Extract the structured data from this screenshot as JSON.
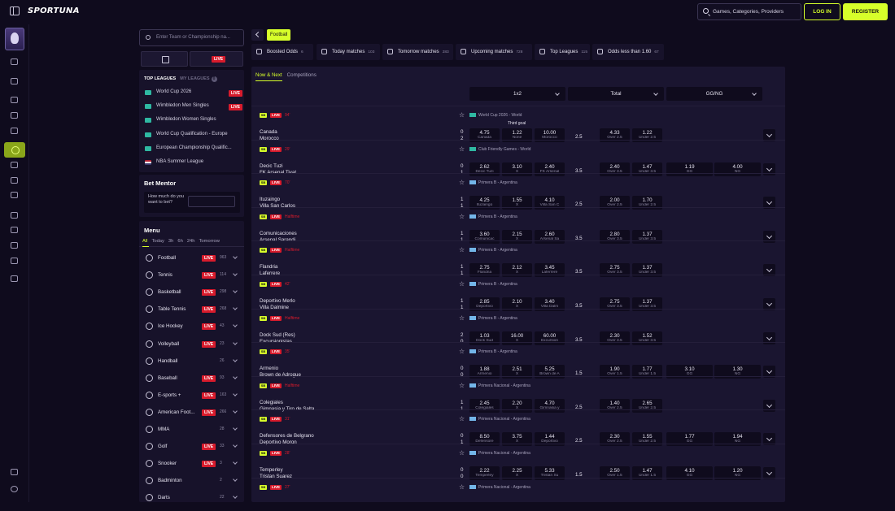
{
  "header": {
    "logo": "SPORTUNA",
    "search_placeholder": "Games, Categories, Providers",
    "login": "LOG IN",
    "register": "REGISTER"
  },
  "sidebar": {
    "search_placeholder": "Enter Team or Championship na...",
    "live_tab": "LIVE",
    "leagues_tabs": {
      "top": "TOP LEAGUES",
      "my": "MY LEAGUES",
      "my_count": "0"
    },
    "leagues": [
      {
        "name": "World Cup 2026",
        "live": "LIVE",
        "flag": "world"
      },
      {
        "name": "Wimbledon Men Singles",
        "live": "LIVE",
        "flag": "world"
      },
      {
        "name": "Wimbledon Women Singles",
        "live": "",
        "flag": "world"
      },
      {
        "name": "World Cup Qualification - Europe",
        "live": "",
        "flag": "world"
      },
      {
        "name": "European Championship Qualific...",
        "live": "",
        "flag": "world"
      },
      {
        "name": "NBA Summer League",
        "live": "",
        "flag": "us"
      }
    ],
    "bet_mentor": {
      "title": "Bet Mentor",
      "question": "How much do you want to bet?"
    },
    "menu": {
      "title": "Menu",
      "time_tabs": [
        "All",
        "Today",
        "3h",
        "6h",
        "24h",
        "Tomorrow"
      ],
      "sports": [
        {
          "name": "Football",
          "live": "LIVE",
          "count": "963"
        },
        {
          "name": "Tennis",
          "live": "LIVE",
          "count": "114"
        },
        {
          "name": "Basketball",
          "live": "LIVE",
          "count": "298"
        },
        {
          "name": "Table Tennis",
          "live": "LIVE",
          "count": "268"
        },
        {
          "name": "Ice Hockey",
          "live": "LIVE",
          "count": "43"
        },
        {
          "name": "Volleyball",
          "live": "LIVE",
          "count": "23"
        },
        {
          "name": "Handball",
          "live": "",
          "count": "26"
        },
        {
          "name": "Baseball",
          "live": "LIVE",
          "count": "93"
        },
        {
          "name": "E-sports +",
          "live": "LIVE",
          "count": "163"
        },
        {
          "name": "American Foot...",
          "live": "LIVE",
          "count": "266"
        },
        {
          "name": "MMA",
          "live": "",
          "count": "28"
        },
        {
          "name": "Golf",
          "live": "LIVE",
          "count": "33"
        },
        {
          "name": "Snooker",
          "live": "LIVE",
          "count": "3"
        },
        {
          "name": "Badminton",
          "live": "",
          "count": "2"
        },
        {
          "name": "Darts",
          "live": "",
          "count": "22"
        }
      ]
    }
  },
  "main": {
    "breadcrumb": "Football",
    "filters": [
      {
        "label": "Boosted Odds",
        "count": "6"
      },
      {
        "label": "Today matches",
        "count": "103"
      },
      {
        "label": "Tomorrow matches",
        "count": "283"
      },
      {
        "label": "Upcoming matches",
        "count": "728"
      },
      {
        "label": "Top Leagues",
        "count": "115"
      },
      {
        "label": "Odds less than 1.60",
        "count": "67"
      }
    ],
    "subtabs": {
      "active": "Now & Next",
      "other": "Competitions"
    },
    "columns": {
      "c1": "1x2",
      "c2": "Total",
      "c3": "GG/NG"
    },
    "matches": [
      {
        "min": "94'",
        "comp": "World Cup 2026 - World",
        "flag": "wc",
        "home": "Canada",
        "away": "Morocco",
        "sh": "0",
        "sa": "2",
        "extra": "Third goal",
        "o1": [
          "4.75",
          "Canada"
        ],
        "ox": [
          "1.22",
          "None"
        ],
        "o2": [
          "10.00",
          "Morocco"
        ],
        "line": "2.5",
        "ov": [
          "4.33",
          "Over 2.5"
        ],
        "un": [
          "1.22",
          "Under 2.5"
        ],
        "gg": null,
        "ng": null
      },
      {
        "min": "29'",
        "comp": "Club Friendly Games - World",
        "flag": "wc",
        "home": "Decic Tuzi",
        "away": "FK Arsenal Tivat",
        "sh": "0",
        "sa": "1",
        "extra": "",
        "o1": [
          "2.62",
          "Decic Tuzi"
        ],
        "ox": [
          "3.10",
          "X"
        ],
        "o2": [
          "2.40",
          "FK Arsenal"
        ],
        "line": "3.5",
        "ov": [
          "2.40",
          "Over 3.5"
        ],
        "un": [
          "1.47",
          "Under 3.5"
        ],
        "gg": [
          "1.19",
          "GG"
        ],
        "ng": [
          "4.00",
          "NG"
        ]
      },
      {
        "min": "70'",
        "comp": "Primera B - Argentina",
        "flag": "ar",
        "home": "Ituzaingo",
        "away": "Villa San Carlos",
        "sh": "1",
        "sa": "1",
        "extra": "",
        "o1": [
          "4.25",
          "Ituzaingo"
        ],
        "ox": [
          "1.55",
          "X"
        ],
        "o2": [
          "4.10",
          "Villa San C"
        ],
        "line": "2.5",
        "ov": [
          "2.00",
          "Over 2.5"
        ],
        "un": [
          "1.70",
          "Under 2.5"
        ],
        "gg": null,
        "ng": null
      },
      {
        "min": "Halftime",
        "comp": "Primera B - Argentina",
        "flag": "ar",
        "home": "Comunicaciones",
        "away": "Arsenal Sarandi",
        "sh": "1",
        "sa": "1",
        "extra": "",
        "o1": [
          "3.60",
          "Comunicac"
        ],
        "ox": [
          "2.15",
          "X"
        ],
        "o2": [
          "2.60",
          "Arsenal Sa"
        ],
        "line": "3.5",
        "ov": [
          "2.80",
          "Over 3.5"
        ],
        "un": [
          "1.37",
          "Under 3.5"
        ],
        "gg": null,
        "ng": null
      },
      {
        "min": "Halftime",
        "comp": "Primera B - Argentina",
        "flag": "ar",
        "home": "Flandria",
        "away": "Laferrere",
        "sh": "1",
        "sa": "1",
        "extra": "",
        "o1": [
          "2.75",
          "Flandria"
        ],
        "ox": [
          "2.12",
          "X"
        ],
        "o2": [
          "3.45",
          "Laferrere"
        ],
        "line": "3.5",
        "ov": [
          "2.75",
          "Over 3.5"
        ],
        "un": [
          "1.37",
          "Under 3.5"
        ],
        "gg": null,
        "ng": null
      },
      {
        "min": "42'",
        "comp": "Primera B - Argentina",
        "flag": "ar",
        "home": "Deportivo Merlo",
        "away": "Villa Dalmine",
        "sh": "1",
        "sa": "1",
        "extra": "",
        "o1": [
          "2.85",
          "Deportivo"
        ],
        "ox": [
          "2.10",
          "X"
        ],
        "o2": [
          "3.40",
          "Villa Dalm"
        ],
        "line": "3.5",
        "ov": [
          "2.75",
          "Over 3.5"
        ],
        "un": [
          "1.37",
          "Under 3.5"
        ],
        "gg": null,
        "ng": null
      },
      {
        "min": "Halftime",
        "comp": "Primera B - Argentina",
        "flag": "ar",
        "home": "Dock Sud (Res)",
        "away": "Excursionistas",
        "sh": "2",
        "sa": "0",
        "extra": "",
        "o1": [
          "1.03",
          "Dock Sud"
        ],
        "ox": [
          "16.00",
          "X"
        ],
        "o2": [
          "60.00",
          "Excursion"
        ],
        "line": "3.5",
        "ov": [
          "2.30",
          "Over 3.5"
        ],
        "un": [
          "1.52",
          "Under 3.5"
        ],
        "gg": null,
        "ng": null
      },
      {
        "min": "35'",
        "comp": "Primera B - Argentina",
        "flag": "ar",
        "home": "Armenio",
        "away": "Brown de Adrogue",
        "sh": "0",
        "sa": "0",
        "extra": "",
        "o1": [
          "1.88",
          "Armenio"
        ],
        "ox": [
          "2.51",
          "X"
        ],
        "o2": [
          "5.25",
          "Brown de A"
        ],
        "line": "1.5",
        "ov": [
          "1.90",
          "Over 1.5"
        ],
        "un": [
          "1.77",
          "Under 1.5"
        ],
        "gg": [
          "3.10",
          "GG"
        ],
        "ng": [
          "1.30",
          "NG"
        ]
      },
      {
        "min": "Halftime",
        "comp": "Primera Nacional - Argentina",
        "flag": "ar",
        "home": "Colegiales",
        "away": "Gimnasia y Tiro de Salta",
        "sh": "1",
        "sa": "1",
        "extra": "",
        "o1": [
          "2.45",
          "Colegiales"
        ],
        "ox": [
          "2.20",
          "X"
        ],
        "o2": [
          "4.70",
          "Gimnasia y"
        ],
        "line": "2.5",
        "ov": [
          "1.40",
          "Over 2.5"
        ],
        "un": [
          "2.65",
          "Under 2.5"
        ],
        "gg": null,
        "ng": null
      },
      {
        "min": "31'",
        "comp": "Primera Nacional - Argentina",
        "flag": "ar",
        "home": "Defensores de Belgrano",
        "away": "Deportivo Moron",
        "sh": "0",
        "sa": "1",
        "extra": "",
        "o1": [
          "8.50",
          "Defensore"
        ],
        "ox": [
          "3.75",
          "X"
        ],
        "o2": [
          "1.44",
          "Deportivo"
        ],
        "line": "2.5",
        "ov": [
          "2.30",
          "Over 2.5"
        ],
        "un": [
          "1.55",
          "Under 2.5"
        ],
        "gg": [
          "1.77",
          "GG"
        ],
        "ng": [
          "1.94",
          "NG"
        ]
      },
      {
        "min": "28'",
        "comp": "Primera Nacional - Argentina",
        "flag": "ar",
        "home": "Temperley",
        "away": "Tristan Suarez",
        "sh": "0",
        "sa": "0",
        "extra": "",
        "o1": [
          "2.22",
          "Temperley"
        ],
        "ox": [
          "2.25",
          "X"
        ],
        "o2": [
          "5.33",
          "Tristan Su"
        ],
        "line": "1.5",
        "ov": [
          "2.50",
          "Over 1.5"
        ],
        "un": [
          "1.47",
          "Under 1.5"
        ],
        "gg": [
          "4.10",
          "GG"
        ],
        "ng": [
          "1.20",
          "NG"
        ]
      },
      {
        "min": "27'",
        "comp": "Primera Nacional - Argentina",
        "flag": "ar",
        "home": "",
        "away": "",
        "sh": "",
        "sa": "",
        "extra": "",
        "o1": null,
        "ox": null,
        "o2": null,
        "line": "",
        "ov": null,
        "un": null,
        "gg": null,
        "ng": null
      }
    ]
  }
}
